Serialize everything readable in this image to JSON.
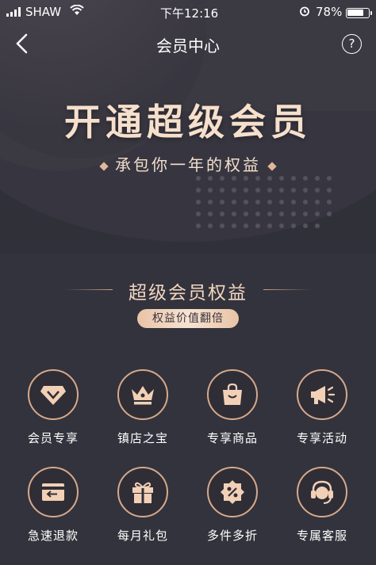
{
  "status_bar": {
    "carrier": "SHAW",
    "time": "下午12:16",
    "battery": "78%",
    "battery_level": 0.78
  },
  "nav": {
    "title": "会员中心",
    "help": "?"
  },
  "hero": {
    "title": "开通超级会员",
    "subtitle": "承包你一年的权益"
  },
  "benefits": {
    "title": "超级会员权益",
    "badge": "权益价值翻倍",
    "items": [
      {
        "label": "会员专享",
        "icon": "diamond-icon"
      },
      {
        "label": "镇店之宝",
        "icon": "crown-icon"
      },
      {
        "label": "专享商品",
        "icon": "shopping-bag-icon"
      },
      {
        "label": "专享活动",
        "icon": "megaphone-icon"
      },
      {
        "label": "急速退款",
        "icon": "refund-card-icon"
      },
      {
        "label": "每月礼包",
        "icon": "gift-icon"
      },
      {
        "label": "多件多折",
        "icon": "discount-tag-icon"
      },
      {
        "label": "专属客服",
        "icon": "customer-service-icon"
      }
    ]
  },
  "colors": {
    "background": "#33333d",
    "accent": "#e0b79a",
    "icon_fill": "#f2d0b6"
  }
}
